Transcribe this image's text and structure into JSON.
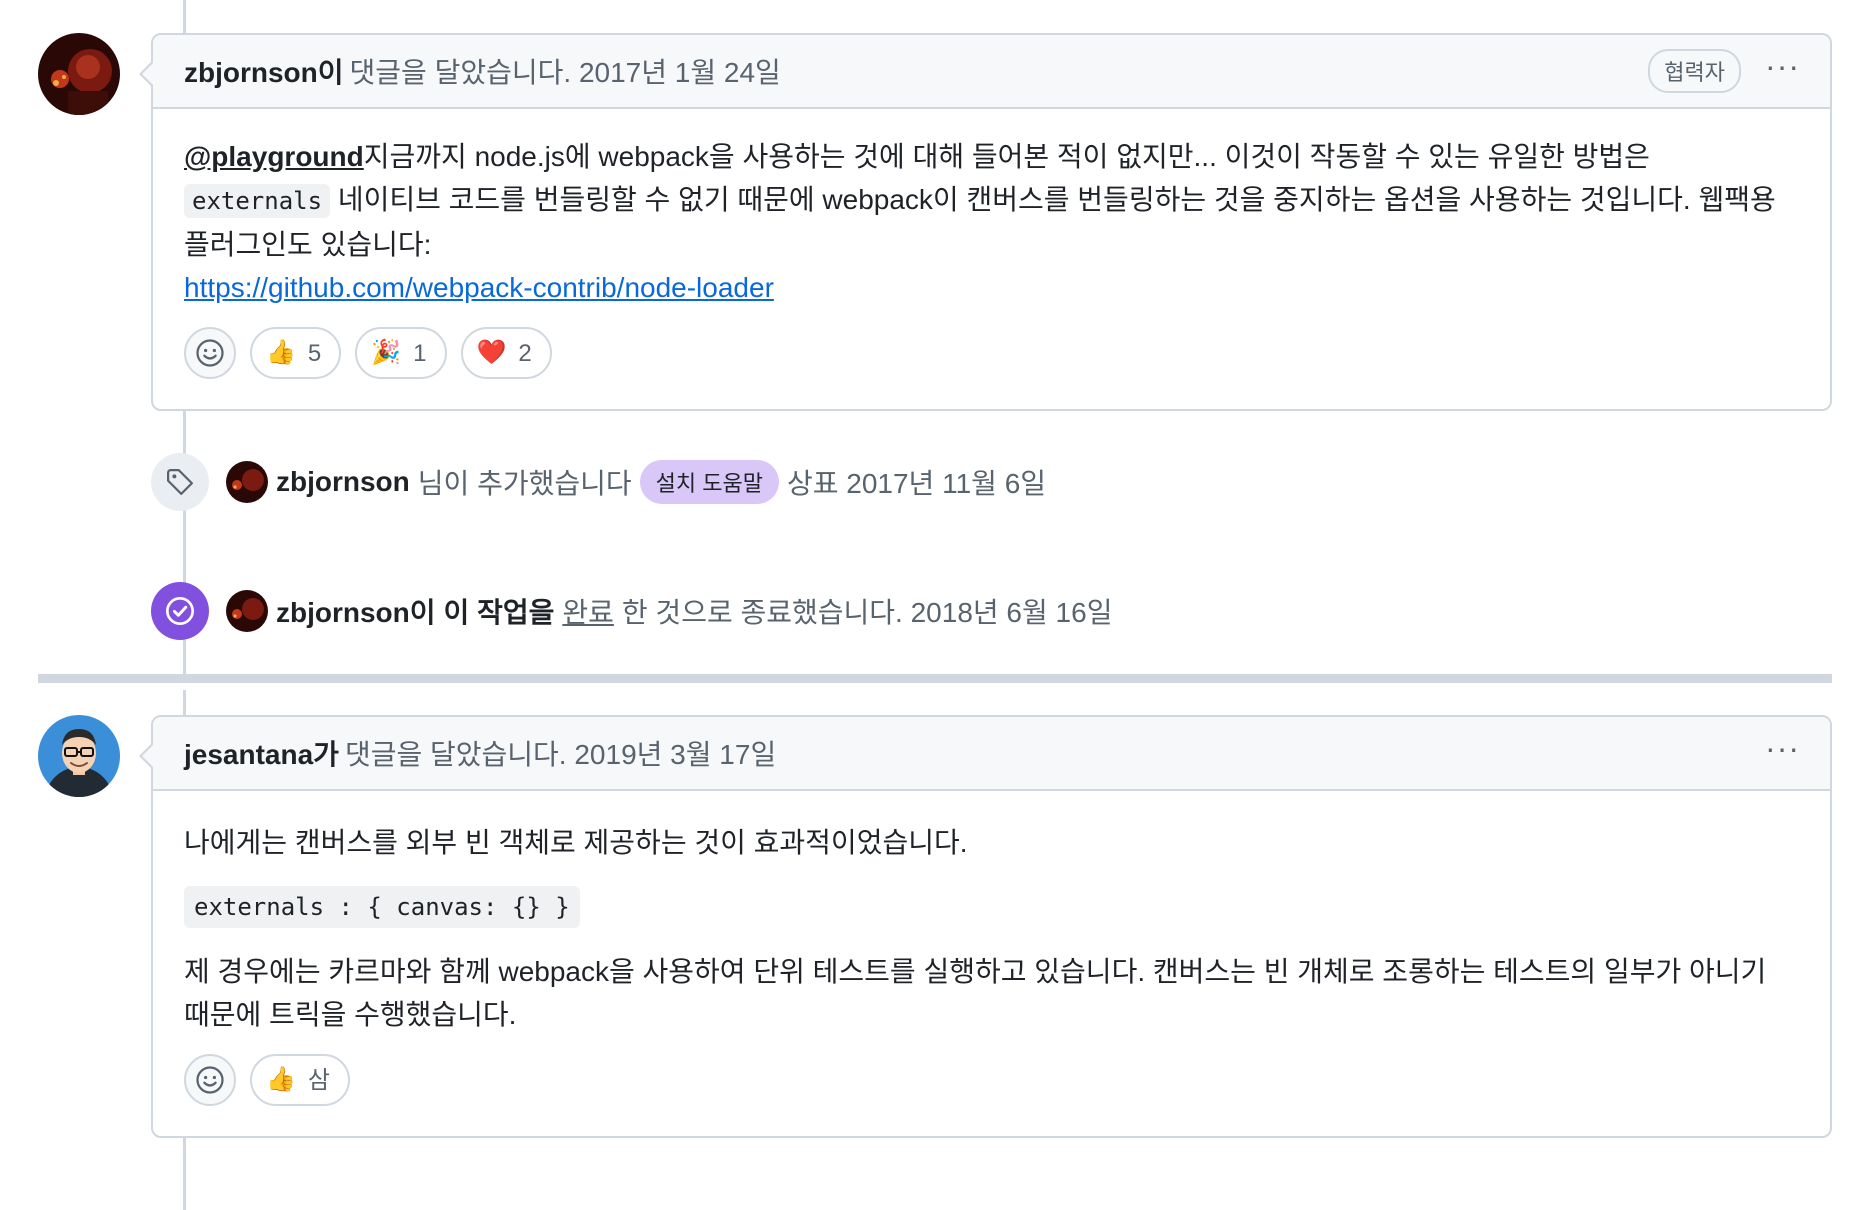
{
  "comment1": {
    "author": "zbjornson이",
    "meta": "댓글을 달았습니다. 2017년 1월 24일",
    "role": "협력자",
    "more": "···",
    "mention": "@playground",
    "text_a": "지금까지 node.js에 webpack을 사용하는 것에 대해 들어본 적이 없지만... 이것이 작동할 수 있는 유일한 방법은 ",
    "code": "externals",
    "text_b": " 네이티브 코드를 번들링할 수 없기 때문에 webpack이 캔버스를 번들링하는 것을 중지하는 옵션을 사용하는 것입니다. 웹팩용 플러그인도 있습니다:",
    "link": "https://github.com/webpack-contrib/node-loader",
    "reactions": [
      {
        "icon": "thumbs-up-icon",
        "emoji": "👍",
        "count": "5"
      },
      {
        "icon": "party-popper-icon",
        "emoji": "🎉",
        "count": "1"
      },
      {
        "icon": "heart-icon",
        "emoji": "❤️",
        "count": "2"
      }
    ]
  },
  "event_label": {
    "icon": "tag-icon",
    "who": "zbjornson",
    "action": "님이 추가했습니다",
    "label": "설치 도움말",
    "suffix": "상표 2017년 11월 6일"
  },
  "event_closed": {
    "icon": "check-circle-icon",
    "who": "zbjornson이",
    "action_strong": "이 작업을",
    "state": "완료",
    "suffix": "한 것으로 종료했습니다. 2018년 6월 16일"
  },
  "comment2": {
    "author": "jesantana가",
    "meta": "댓글을 달았습니다. 2019년 3월 17일",
    "more": "···",
    "p1": "나에게는 캔버스를 외부 빈 객체로 제공하는 것이 효과적이었습니다.",
    "code": "externals : { canvas: {} }",
    "p2": "제 경우에는 카르마와 함께 webpack을 사용하여 단위 테스트를 실행하고 있습니다. 캔버스는 빈 개체로 조롱하는 테스트의 일부가 아니기 때문에 트릭을 수행했습니다.",
    "reactions": [
      {
        "icon": "thumbs-up-icon",
        "emoji": "👍",
        "count": "삼"
      }
    ]
  },
  "colors": {
    "link": "#0969da",
    "label_bg": "#d8c7f7",
    "closed_badge": "#8250df",
    "border": "#d0d7de",
    "header_bg": "#f6f8fa"
  }
}
